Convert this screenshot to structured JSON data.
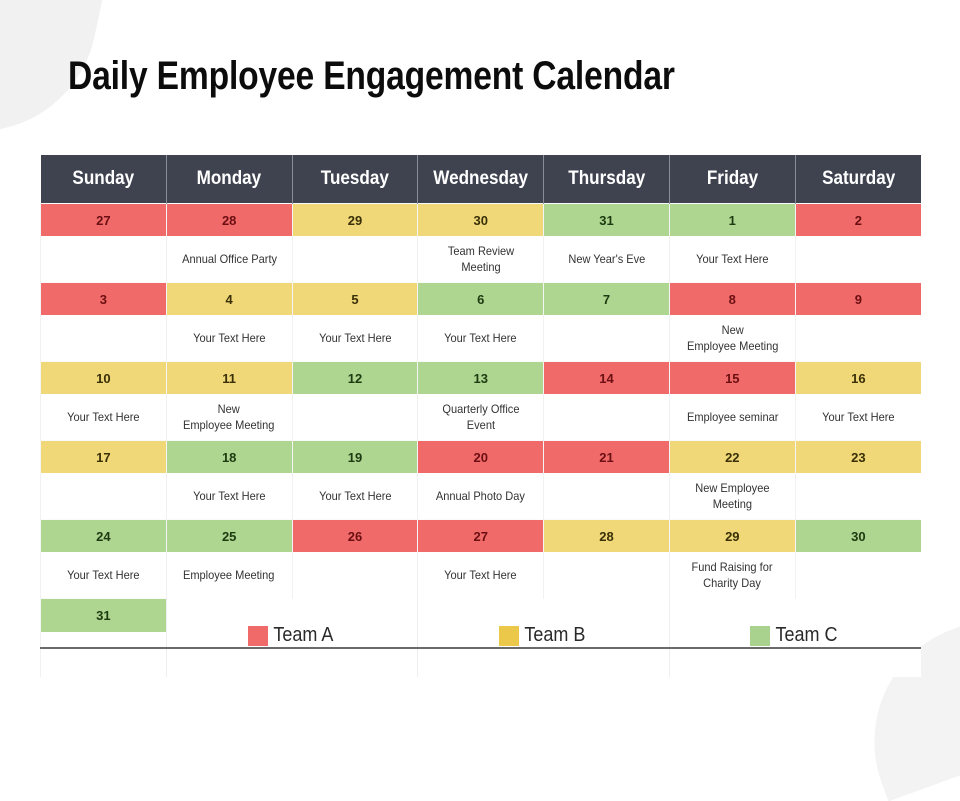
{
  "title": "Daily Employee Engagement Calendar",
  "colors": {
    "team_a": "#f06a6a",
    "team_b": "#f0d878",
    "team_c": "#aed691",
    "header": "#3f4350"
  },
  "days": [
    "Sunday",
    "Monday",
    "Tuesday",
    "Wednesday",
    "Thursday",
    "Friday",
    "Saturday"
  ],
  "weeks": [
    {
      "dates": [
        {
          "day": "27",
          "team": "a",
          "note": ""
        },
        {
          "day": "28",
          "team": "a",
          "note": "Annual Office Party"
        },
        {
          "day": "29",
          "team": "b",
          "note": ""
        },
        {
          "day": "30",
          "team": "b",
          "note": "Team Review\nMeeting"
        },
        {
          "day": "31",
          "team": "c",
          "note": "New Year's Eve"
        },
        {
          "day": "1",
          "team": "c",
          "note": "Your Text Here"
        },
        {
          "day": "2",
          "team": "a",
          "note": ""
        }
      ]
    },
    {
      "dates": [
        {
          "day": "3",
          "team": "a",
          "note": ""
        },
        {
          "day": "4",
          "team": "b",
          "note": "Your Text Here"
        },
        {
          "day": "5",
          "team": "b",
          "note": "Your Text Here"
        },
        {
          "day": "6",
          "team": "c",
          "note": "Your Text Here"
        },
        {
          "day": "7",
          "team": "c",
          "note": ""
        },
        {
          "day": "8",
          "team": "a",
          "note": "New\nEmployee Meeting"
        },
        {
          "day": "9",
          "team": "a",
          "note": ""
        }
      ]
    },
    {
      "dates": [
        {
          "day": "10",
          "team": "b",
          "note": "Your Text Here"
        },
        {
          "day": "11",
          "team": "b",
          "note": "New\nEmployee Meeting"
        },
        {
          "day": "12",
          "team": "c",
          "note": ""
        },
        {
          "day": "13",
          "team": "c",
          "note": "Quarterly Office\nEvent"
        },
        {
          "day": "14",
          "team": "a",
          "note": ""
        },
        {
          "day": "15",
          "team": "a",
          "note": "Employee seminar"
        },
        {
          "day": "16",
          "team": "b",
          "note": "Your Text Here"
        }
      ]
    },
    {
      "dates": [
        {
          "day": "17",
          "team": "b",
          "note": ""
        },
        {
          "day": "18",
          "team": "c",
          "note": "Your Text Here"
        },
        {
          "day": "19",
          "team": "c",
          "note": "Your Text Here"
        },
        {
          "day": "20",
          "team": "a",
          "note": "Annual Photo Day"
        },
        {
          "day": "21",
          "team": "a",
          "note": ""
        },
        {
          "day": "22",
          "team": "b",
          "note": "New Employee\nMeeting"
        },
        {
          "day": "23",
          "team": "b",
          "note": ""
        }
      ]
    },
    {
      "dates": [
        {
          "day": "24",
          "team": "c",
          "note": "Your Text Here"
        },
        {
          "day": "25",
          "team": "c",
          "note": "Employee Meeting"
        },
        {
          "day": "26",
          "team": "a",
          "note": ""
        },
        {
          "day": "27",
          "team": "a",
          "note": "Your Text Here"
        },
        {
          "day": "28",
          "team": "b",
          "note": ""
        },
        {
          "day": "29",
          "team": "b",
          "note": "Fund Raising for\nCharity Day"
        },
        {
          "day": "30",
          "team": "c",
          "note": ""
        }
      ]
    }
  ],
  "last_day": {
    "day": "31",
    "team": "c",
    "note": ""
  },
  "legend": [
    {
      "label": "Team A",
      "team": "a",
      "color": "#f06a6a"
    },
    {
      "label": "Team B",
      "team": "b",
      "color": "#ecc84a"
    },
    {
      "label": "Team C",
      "team": "c",
      "color": "#a8d28d"
    }
  ]
}
